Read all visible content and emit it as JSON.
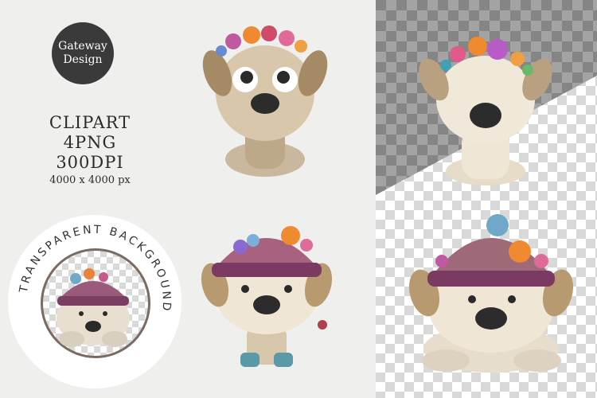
{
  "logo": {
    "line1": "Gateway",
    "line2": "Design"
  },
  "info": {
    "line1": "CLIPART",
    "line2": "4PNG",
    "line3": "300DPI",
    "line4": "4000 x 4000 px"
  },
  "badge": {
    "ring_text": "TRANSPARENT BACKGROUND"
  },
  "icons": [
    "dog-flower-crown-icon",
    "dog-knit-hat-icon"
  ]
}
